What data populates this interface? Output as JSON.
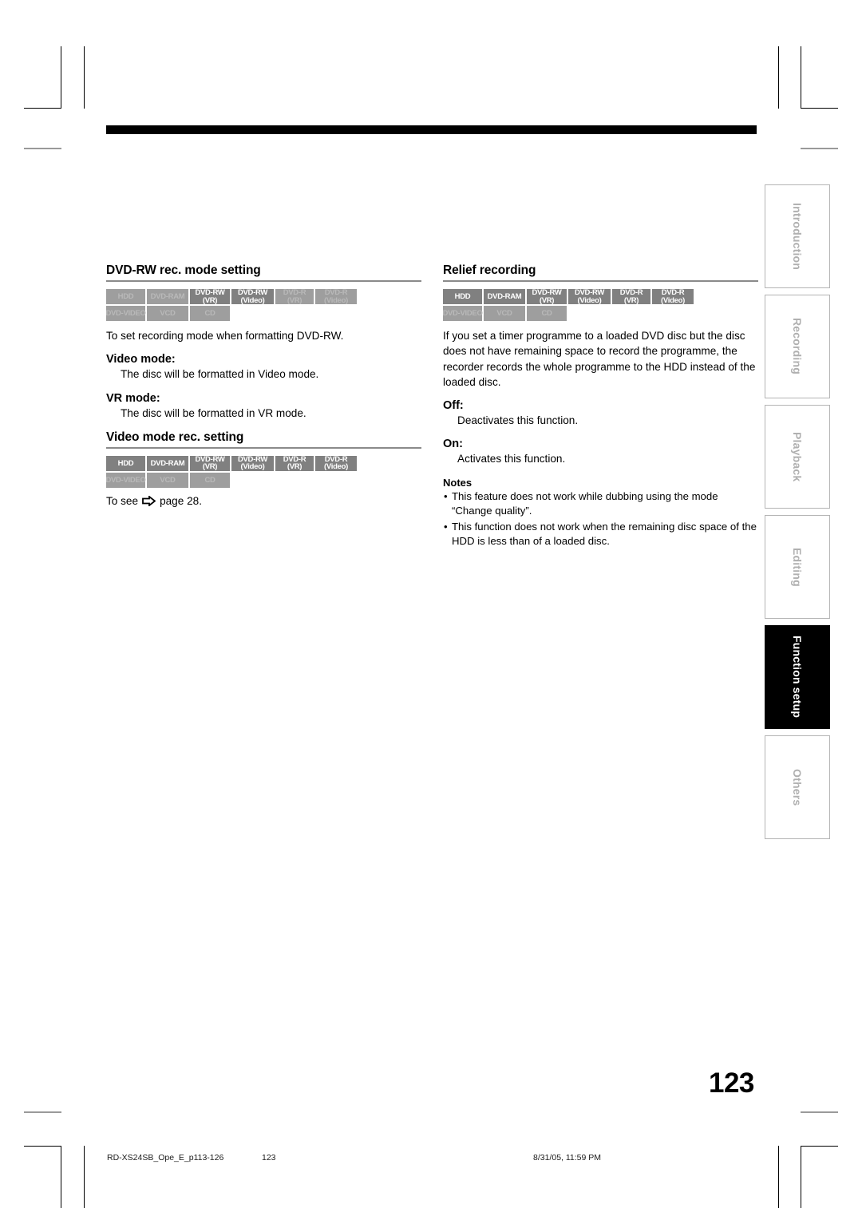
{
  "page": {
    "number": "123",
    "footer": {
      "file": "RD-XS24SB_Ope_E_p113-126",
      "page": "123",
      "date": "8/31/05, 11:59 PM"
    }
  },
  "side_tabs": [
    {
      "label": "Introduction",
      "active": false
    },
    {
      "label": "Recording",
      "active": false
    },
    {
      "label": "Playback",
      "active": false
    },
    {
      "label": "Editing",
      "active": false
    },
    {
      "label": "Function setup",
      "active": true
    },
    {
      "label": "Others",
      "active": false
    }
  ],
  "left_column": {
    "section1": {
      "title": "DVD-RW rec. mode setting",
      "badges": {
        "row1": [
          {
            "line1": "HDD",
            "line2": "",
            "on": false
          },
          {
            "line1": "DVD-RAM",
            "line2": "",
            "on": false
          },
          {
            "line1": "DVD-RW",
            "line2": "(VR)",
            "on": true
          },
          {
            "line1": "DVD-RW",
            "line2": "(Video)",
            "on": true
          },
          {
            "line1": "DVD-R",
            "line2": "(VR)",
            "on": false
          },
          {
            "line1": "DVD-R",
            "line2": "(Video)",
            "on": false
          }
        ],
        "row2": [
          {
            "line1": "DVD-VIDEO",
            "line2": "",
            "on": false
          },
          {
            "line1": "VCD",
            "line2": "",
            "on": false
          },
          {
            "line1": "CD",
            "line2": "",
            "on": false
          }
        ]
      },
      "intro": "To set recording mode when formatting DVD-RW.",
      "items": [
        {
          "head": "Video mode:",
          "body": "The disc will be formatted in Video mode."
        },
        {
          "head": "VR mode:",
          "body": "The disc will be formatted in VR mode."
        }
      ]
    },
    "section2": {
      "title": "Video mode rec. setting",
      "badges": {
        "row1": [
          {
            "line1": "HDD",
            "line2": "",
            "on": true
          },
          {
            "line1": "DVD-RAM",
            "line2": "",
            "on": true
          },
          {
            "line1": "DVD-RW",
            "line2": "(VR)",
            "on": true
          },
          {
            "line1": "DVD-RW",
            "line2": "(Video)",
            "on": true
          },
          {
            "line1": "DVD-R",
            "line2": "(VR)",
            "on": true
          },
          {
            "line1": "DVD-R",
            "line2": "(Video)",
            "on": true
          }
        ],
        "row2": [
          {
            "line1": "DVD-VIDEO",
            "line2": "",
            "on": false
          },
          {
            "line1": "VCD",
            "line2": "",
            "on": false
          },
          {
            "line1": "CD",
            "line2": "",
            "on": false
          }
        ]
      },
      "see_prefix": "To see",
      "see_suffix": "page 28.",
      "arrow_icon": "right-arrow-icon"
    }
  },
  "right_column": {
    "section1": {
      "title": "Relief recording",
      "badges": {
        "row1": [
          {
            "line1": "HDD",
            "line2": "",
            "on": true
          },
          {
            "line1": "DVD-RAM",
            "line2": "",
            "on": true
          },
          {
            "line1": "DVD-RW",
            "line2": "(VR)",
            "on": true
          },
          {
            "line1": "DVD-RW",
            "line2": "(Video)",
            "on": true
          },
          {
            "line1": "DVD-R",
            "line2": "(VR)",
            "on": true
          },
          {
            "line1": "DVD-R",
            "line2": "(Video)",
            "on": true
          }
        ],
        "row2": [
          {
            "line1": "DVD-VIDEO",
            "line2": "",
            "on": false
          },
          {
            "line1": "VCD",
            "line2": "",
            "on": false
          },
          {
            "line1": "CD",
            "line2": "",
            "on": false
          }
        ]
      },
      "intro": "If you set a timer programme to a loaded DVD disc but the disc does not have remaining space to record the programme, the recorder records the whole programme to the HDD instead of the loaded disc.",
      "items": [
        {
          "head": "Off:",
          "body": "Deactivates this function."
        },
        {
          "head": "On:",
          "body": "Activates this function."
        }
      ],
      "notes_head": "Notes",
      "notes": [
        "This feature does not work while dubbing using the mode “Change quality”.",
        "This function does not work when the remaining disc space of the HDD is less than of a loaded disc."
      ]
    }
  }
}
